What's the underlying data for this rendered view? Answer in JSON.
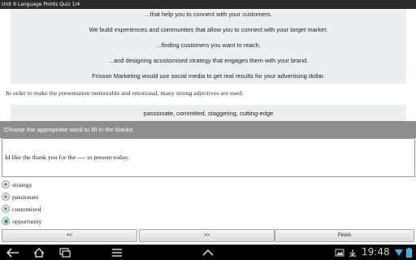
{
  "window": {
    "title": "Unit 6 Language Points Quiz 1/4"
  },
  "passage": {
    "lines": [
      "...that help you to connect with your customers.",
      "We build experiences and communties that allow you to connect with your target market.",
      "...finding customers you want to reach.",
      "...and designing acustomised strategy that engages them with your brand.",
      "Frisson Marketing would use social media to get real results for your advertising dollar."
    ],
    "intro": "In order to make the presentation memorable and emotional, many strong adjectives are used:",
    "adjectives": "passionate, committed, staggering, cutting-edge"
  },
  "instruction": "Choose the appropriate word to fill in the blanks.",
  "question": "Id like the thank you for the ---- to present today.",
  "options": [
    {
      "label": "strategy",
      "selected": false
    },
    {
      "label": "passionate",
      "selected": false
    },
    {
      "label": "customized",
      "selected": false
    },
    {
      "label": "opportunity",
      "selected": true
    }
  ],
  "nav": {
    "prev": "<<",
    "next": ">>",
    "finish": "Finish"
  },
  "status_bar": {
    "time": "19:48",
    "icons": [
      "back-icon",
      "home-icon",
      "recent-apps-icon",
      "menu-icon",
      "up-arrow-icon",
      "gallery-icon",
      "download-icon",
      "wifi-icon",
      "battery-icon"
    ]
  },
  "colors": {
    "panel": "#e9eff3",
    "instruction_bar": "#8e8e8e",
    "selected_radio": "#22b14c"
  }
}
